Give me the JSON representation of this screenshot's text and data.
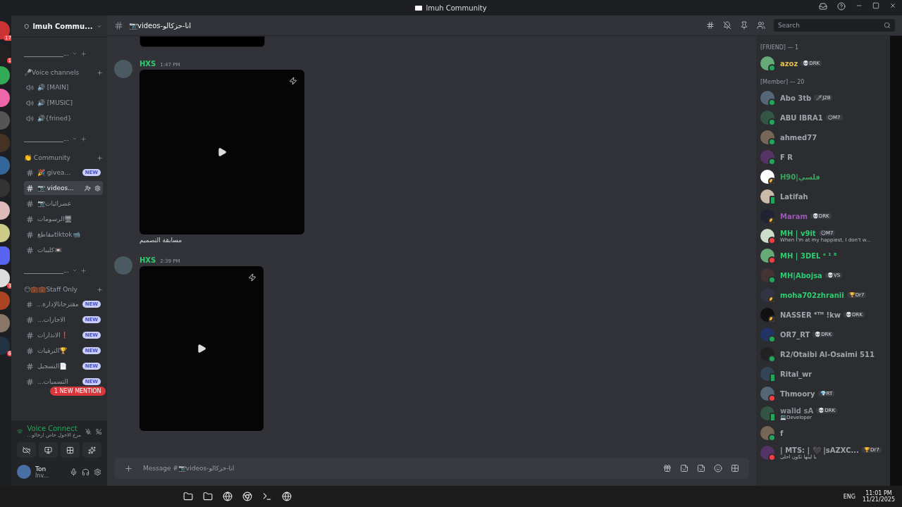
{
  "window": {
    "title": "lmuh Community"
  },
  "server_rail": [
    {
      "kind": "server",
      "badge": "17"
    },
    {
      "kind": "server",
      "badge": "1"
    },
    {
      "kind": "server"
    },
    {
      "kind": "server"
    },
    {
      "kind": "server"
    },
    {
      "kind": "server"
    },
    {
      "kind": "server"
    },
    {
      "kind": "server"
    },
    {
      "kind": "server"
    },
    {
      "kind": "server"
    },
    {
      "kind": "folder"
    },
    {
      "kind": "server",
      "badge": "3"
    },
    {
      "kind": "server"
    },
    {
      "kind": "server"
    },
    {
      "kind": "server",
      "badge": "6"
    }
  ],
  "sidebar": {
    "server_name": "lmuh Commu...",
    "sections": [
      {
        "kind": "divider",
        "name": "______________..."
      },
      {
        "kind": "category",
        "name": "🎤Voice channels",
        "channels": [
          {
            "kind": "voice",
            "name": "🔊 [MAIN]",
            "selected": false
          },
          {
            "kind": "voice",
            "name": "🔊 [MUSIC]",
            "selected": false
          },
          {
            "kind": "voice",
            "name": "🔊{frined}",
            "selected": false
          }
        ]
      },
      {
        "kind": "divider",
        "name": "______________..."
      },
      {
        "kind": "category",
        "name": "👏 Community",
        "channels": [
          {
            "kind": "text",
            "name": "🎉 givea...",
            "badge": "NEW",
            "selected": false
          },
          {
            "kind": "text",
            "name": "📷 videos...",
            "selected": true
          },
          {
            "kind": "text",
            "name": "📷عضرائيات",
            "selected": false
          },
          {
            "kind": "text",
            "name": "الرسومات🖥",
            "selected": false
          },
          {
            "kind": "text",
            "name": "مقاطعtiktok📹",
            "selected": false
          },
          {
            "kind": "text",
            "name": "كليبات📼",
            "selected": false
          }
        ]
      },
      {
        "kind": "divider",
        "name": "______________..."
      },
      {
        "kind": "category",
        "name": "😶💼💼Staff Only",
        "channels": [
          {
            "kind": "text",
            "name": "...مقترحاتالإدارة",
            "badge": "NEW",
            "selected": false
          },
          {
            "kind": "text",
            "name": "...الاجازات",
            "badge": "NEW",
            "selected": false
          },
          {
            "kind": "text",
            "name": "الانذارات❗",
            "badge": "NEW",
            "selected": false
          },
          {
            "kind": "text",
            "name": "الترقيات🏆",
            "badge": "NEW",
            "selected": false
          },
          {
            "kind": "text",
            "name": "التسجيل📄",
            "badge": "NEW",
            "selected": false
          },
          {
            "kind": "text",
            "name": "...التسميات",
            "badge": "NEW",
            "selected": false
          }
        ]
      }
    ],
    "mention_pill": "1 NEW MENTION",
    "voice_panel": {
      "status": "Voice Connect",
      "channel": "...مرع الاحول حاص ارخالو"
    },
    "user": {
      "name": "Ton",
      "status": "Inv..."
    }
  },
  "header": {
    "channel": "📷videos-انا-حزكالو",
    "search_placeholder": "Search"
  },
  "messages": [
    {
      "author": "HXS",
      "time": "1:47 PM",
      "caption": "مسابقة التصميم"
    },
    {
      "author": "HXS",
      "time": "2:39 PM"
    }
  ],
  "composer": {
    "placeholder": "Message #📷videos-انا-حزكالو"
  },
  "members": [
    {
      "heading": "[FRIEND] — 1",
      "items": [
        {
          "name": "azoz",
          "color": "#e0c050",
          "tag": "💀DRK",
          "idle": false,
          "dnd": false,
          "mobile": false
        }
      ]
    },
    {
      "heading": "[Member] — 20",
      "items": [
        {
          "name": "Abo 3tb",
          "color": "#a0a4ab",
          "tag": "🗡J2B",
          "idle": false,
          "dnd": false,
          "mobile": false
        },
        {
          "name": "ABU IBRA1",
          "color": "#a0a4ab",
          "tag": "😶M7",
          "idle": false,
          "dnd": false,
          "mobile": false
        },
        {
          "name": "ahmed77",
          "color": "#a0a4ab",
          "idle": false,
          "dnd": false,
          "mobile": false
        },
        {
          "name": "F R",
          "color": "#a0a4ab",
          "idle": false,
          "dnd": false,
          "mobile": false
        },
        {
          "name": "H90|فلسي",
          "color": "#3ba55c",
          "idle": true,
          "dnd": false,
          "mobile": false
        },
        {
          "name": "Latifah",
          "color": "#a0a4ab",
          "idle": false,
          "dnd": false,
          "mobile": true
        },
        {
          "name": "Maram",
          "color": "#9b59b6",
          "tag": "💀DRK",
          "idle": true,
          "dnd": false,
          "mobile": false
        },
        {
          "name": "MH | v9it",
          "color": "#2ecc71",
          "tag": "😶M7",
          "idle": false,
          "dnd": true,
          "mobile": false,
          "sub": "When I'm at my happiest, I don't w..."
        },
        {
          "name": "MH | 3DEL ˢ ¹ ⁸",
          "color": "#2ecc71",
          "idle": false,
          "dnd": true,
          "mobile": false
        },
        {
          "name": "MH|Abojsa",
          "color": "#2ecc71",
          "tag": "💀VS",
          "idle": false,
          "dnd": false,
          "mobile": false
        },
        {
          "name": "moha702zhranii",
          "color": "#2ecc71",
          "tag": "🏆Dr7",
          "idle": true,
          "dnd": false,
          "mobile": false
        },
        {
          "name": "NASSER ⁴ᵀᴴ !kw",
          "color": "#a0a4ab",
          "tag": "💀DRK",
          "idle": true,
          "dnd": false,
          "mobile": false
        },
        {
          "name": "OR7_RT",
          "color": "#a0a4ab",
          "tag": "💀DRK",
          "idle": false,
          "dnd": false,
          "mobile": false
        },
        {
          "name": "R2/Otaibi Al-Osaimi 511",
          "color": "#a0a4ab",
          "idle": false,
          "dnd": false,
          "mobile": false
        },
        {
          "name": "Rital_wr",
          "color": "#a0a4ab",
          "idle": false,
          "dnd": false,
          "mobile": true
        },
        {
          "name": "Thmoory",
          "color": "#a0a4ab",
          "tag": "💎RT",
          "idle": false,
          "dnd": true,
          "mobile": false
        },
        {
          "name": "walid sA",
          "color": "#8a8e96",
          "tag": "💀DRK",
          "idle": false,
          "dnd": false,
          "mobile": true,
          "sub": "💻Developer"
        },
        {
          "name": "f",
          "color": "#a0a4ab",
          "idle": false,
          "dnd": false,
          "mobile": false
        },
        {
          "name": "| MTS: | 🖤 |sAZXC...",
          "color": "#a0a4ab",
          "tag": "🏆Dr7",
          "idle": false,
          "dnd": true,
          "mobile": false,
          "sub": "يا ليتها تكون احلى"
        }
      ]
    }
  ],
  "taskbar": {
    "language": "ENG",
    "time": "11:01 PM",
    "date": "11/21/2025"
  }
}
